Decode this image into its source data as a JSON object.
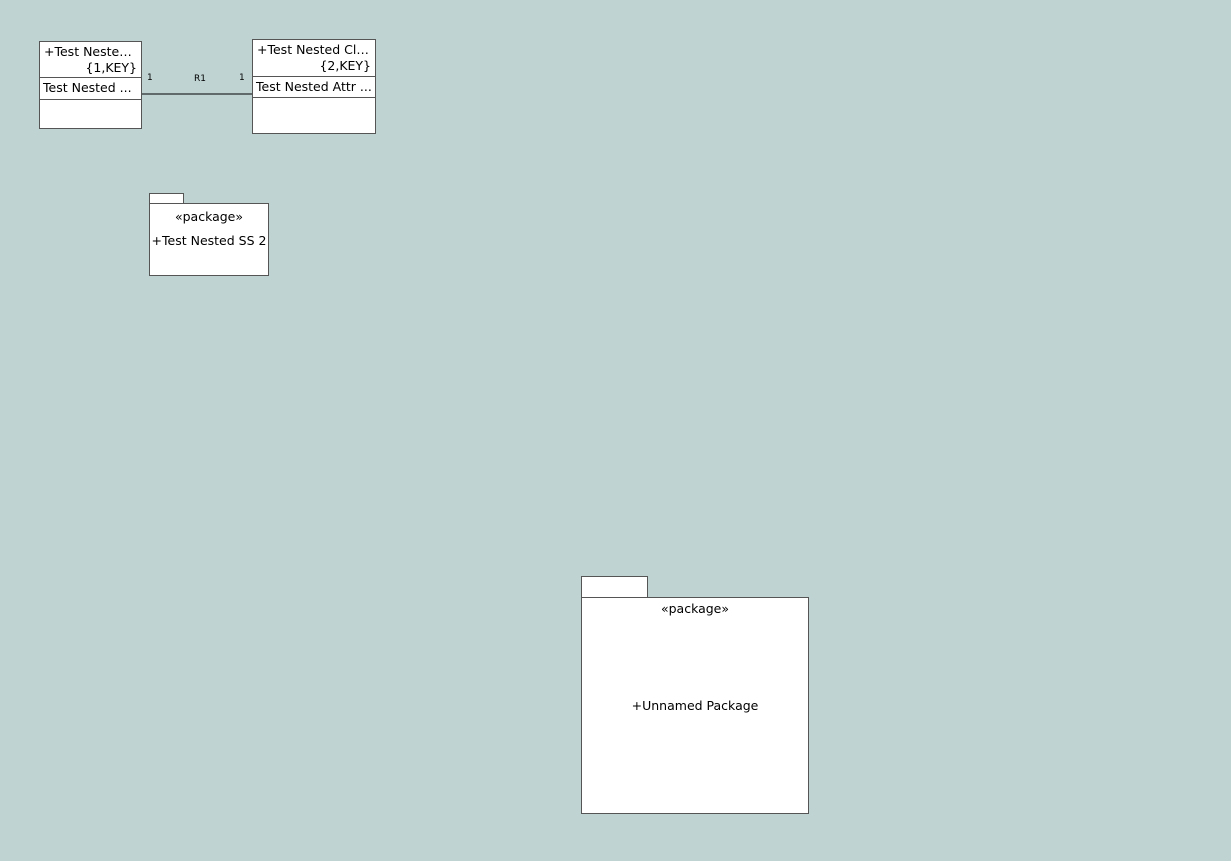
{
  "diagram": {
    "classes": [
      {
        "name": "+Test Nested...",
        "key": "{1,KEY}",
        "attribute": "Test Nested ..."
      },
      {
        "name": "+Test Nested Cla...",
        "key": "{2,KEY}",
        "attribute": "Test Nested Attr ..."
      }
    ],
    "association": {
      "name": "R1",
      "left_multiplicity": "1",
      "right_multiplicity": "1"
    },
    "packages": [
      {
        "stereotype": "«package»",
        "name": "+Test Nested SS 2"
      },
      {
        "stereotype": "«package»",
        "name": "+Unnamed Package"
      }
    ]
  },
  "colors": {
    "canvas_background": "#bfd3d3",
    "element_fill": "#ffffff",
    "element_border": "#555555"
  }
}
